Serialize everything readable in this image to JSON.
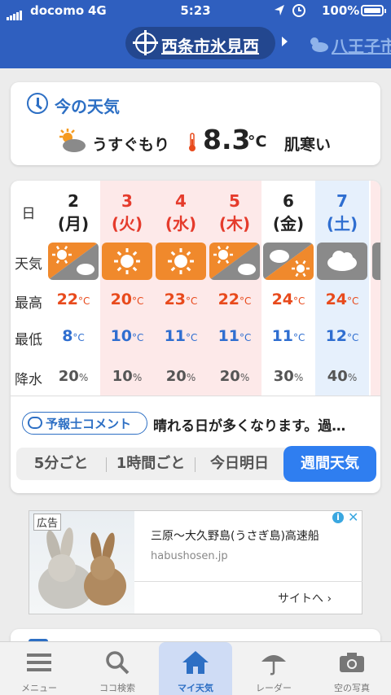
{
  "status_bar": {
    "carrier": "docomo",
    "network": "4G",
    "time": "5:23",
    "battery": "100%",
    "icons": [
      "location-arrow-icon",
      "alarm-icon"
    ]
  },
  "header": {
    "location": "西条市氷見西",
    "next_location": "八王子市",
    "location_icon": "target-icon"
  },
  "current": {
    "title": "今の天気",
    "condition": "うすぐもり",
    "temp": "8.3",
    "unit": "°C",
    "feel": "肌寒い"
  },
  "weekly": {
    "labels": {
      "day": "日",
      "weather": "天気",
      "high": "最高",
      "low": "最低",
      "precip": "降水"
    },
    "unit_temp": "°C",
    "unit_precip": "%",
    "days": [
      {
        "date": "2",
        "weekday": "(月)",
        "color": "black",
        "weather": "sunny-then-cloudy",
        "high": "22",
        "low": "8",
        "precip": "20"
      },
      {
        "date": "3",
        "weekday": "(火)",
        "color": "red",
        "weather": "sunny",
        "high": "20",
        "low": "10",
        "precip": "10"
      },
      {
        "date": "4",
        "weekday": "(水)",
        "color": "red",
        "weather": "sunny",
        "high": "23",
        "low": "11",
        "precip": "20"
      },
      {
        "date": "5",
        "weekday": "(木)",
        "color": "red",
        "weather": "sunny-then-cloudy",
        "high": "22",
        "low": "11",
        "precip": "20"
      },
      {
        "date": "6",
        "weekday": "(金)",
        "color": "black",
        "weather": "cloudy-then-sunny",
        "high": "24",
        "low": "11",
        "precip": "30"
      },
      {
        "date": "7",
        "weekday": "(土)",
        "color": "blue",
        "weather": "cloudy",
        "high": "24",
        "low": "12",
        "precip": "40"
      }
    ],
    "comment_label": "予報士コメント",
    "comment_text": "晴れる日が多くなります。過…",
    "segments": [
      "5分ごと",
      "1時間ごと",
      "今日明日",
      "週間天気"
    ],
    "active_segment": "週間天気"
  },
  "ad": {
    "tag": "広告",
    "title": "三原〜大久野島(うさぎ島)高速船",
    "domain": "habushosen.jp",
    "cta": "サイトへ ›"
  },
  "tabbar": {
    "items": [
      {
        "label": "メニュー",
        "icon": "menu-icon"
      },
      {
        "label": "ココ検索",
        "icon": "search-icon"
      },
      {
        "label": "マイ天気",
        "icon": "home-icon",
        "active": true
      },
      {
        "label": "レーダー",
        "icon": "umbrella-icon"
      },
      {
        "label": "空の写真",
        "icon": "camera-icon"
      }
    ]
  },
  "colors": {
    "header": "#2f5fbf",
    "accent": "#2d6fc4",
    "high": "#e84a1c",
    "low": "#2f6ed0",
    "active_tab": "#2f7ef0"
  }
}
